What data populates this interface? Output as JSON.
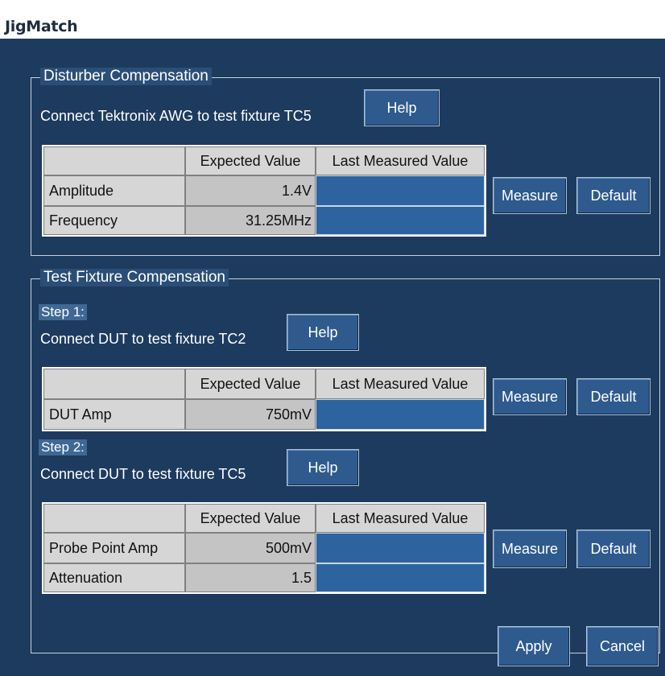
{
  "window": {
    "title": "JigMatch"
  },
  "disturber": {
    "group_label": "Disturber Compensation",
    "instruction": "Connect Tektronix AWG to test fixture TC5",
    "help_label": "Help",
    "headers": [
      "",
      "Expected Value",
      "Last Measured Value"
    ],
    "rows": [
      {
        "label": "Amplitude",
        "expected": "1.4V",
        "measured": ""
      },
      {
        "label": "Frequency",
        "expected": "31.25MHz",
        "measured": ""
      }
    ],
    "measure_label": "Measure",
    "default_label": "Default"
  },
  "fixture": {
    "group_label": "Test Fixture Compensation",
    "step1": {
      "step_label": "Step 1:",
      "instruction": "Connect DUT to test fixture TC2",
      "help_label": "Help",
      "headers": [
        "",
        "Expected Value",
        "Last Measured Value"
      ],
      "rows": [
        {
          "label": "DUT Amp",
          "expected": "750mV",
          "measured": ""
        }
      ],
      "measure_label": "Measure",
      "default_label": "Default"
    },
    "step2": {
      "step_label": "Step 2:",
      "instruction": "Connect DUT to test fixture TC5",
      "help_label": "Help",
      "headers": [
        "",
        "Expected Value",
        "Last Measured Value"
      ],
      "rows": [
        {
          "label": "Probe Point Amp",
          "expected": "500mV",
          "measured": ""
        },
        {
          "label": "Attenuation",
          "expected": "1.5",
          "measured": ""
        }
      ],
      "measure_label": "Measure",
      "default_label": "Default"
    }
  },
  "footer": {
    "apply_label": "Apply",
    "cancel_label": "Cancel"
  }
}
